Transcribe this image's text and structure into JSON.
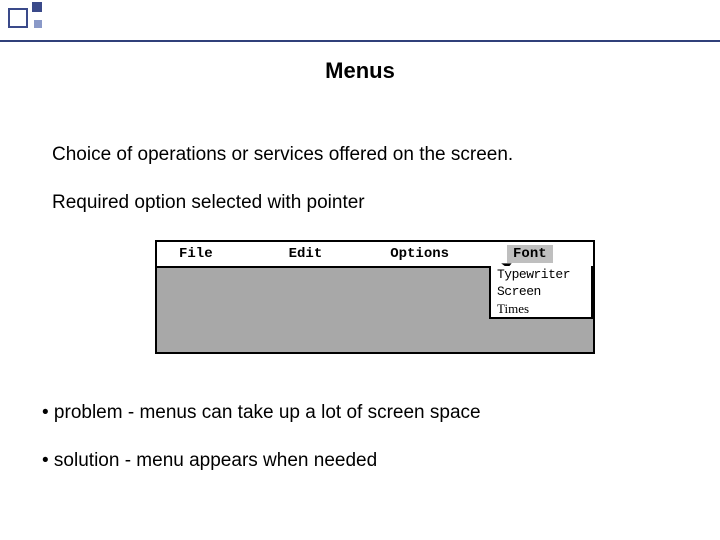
{
  "title": "Menus",
  "body": {
    "line1": "Choice of operations or services offered on the screen.",
    "line2": "Required option selected with pointer"
  },
  "menubar": {
    "items": [
      "File",
      "Edit",
      "Options",
      "Font"
    ],
    "active": "Font"
  },
  "dropdown": {
    "items": [
      "Typewriter",
      "Screen",
      "Times"
    ]
  },
  "bullets": {
    "b1": "• problem - menus can take up a lot of screen space",
    "b2": "• solution - menu appears when needed"
  }
}
